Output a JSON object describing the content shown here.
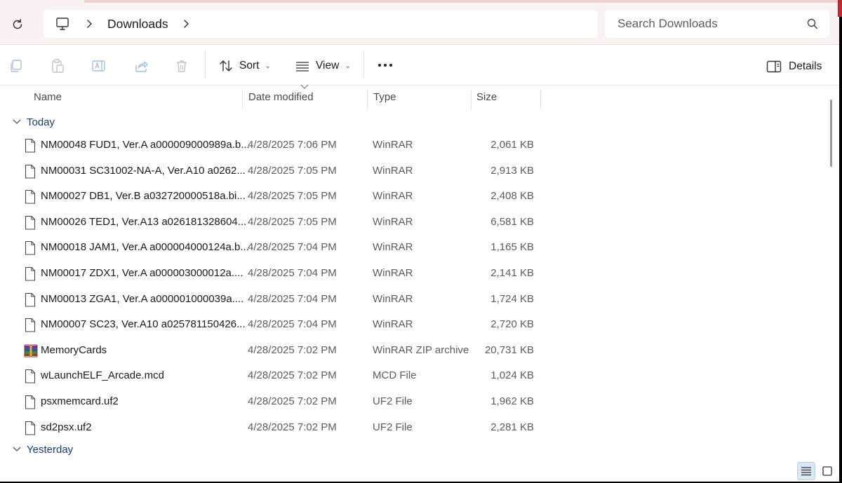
{
  "address": {
    "breadcrumb": "Downloads",
    "search_placeholder": "Search Downloads"
  },
  "toolbar": {
    "sort_label": "Sort",
    "view_label": "View",
    "details_label": "Details"
  },
  "columns": {
    "name": "Name",
    "date": "Date modified",
    "type": "Type",
    "size": "Size"
  },
  "groups": {
    "today": "Today",
    "yesterday": "Yesterday"
  },
  "files": [
    {
      "name": "NM00048 FUD1, Ver.A a000009000989a.b...",
      "date": "4/28/2025 7:06 PM",
      "type": "WinRAR",
      "size": "2,061 KB",
      "icon": "file-icon"
    },
    {
      "name": "NM00031 SC31002-NA-A, Ver.A10 a0262...",
      "date": "4/28/2025 7:05 PM",
      "type": "WinRAR",
      "size": "2,913 KB",
      "icon": "file-icon"
    },
    {
      "name": "NM00027 DB1, Ver.B a032720000518a.bi...",
      "date": "4/28/2025 7:05 PM",
      "type": "WinRAR",
      "size": "2,408 KB",
      "icon": "file-icon"
    },
    {
      "name": "NM00026 TED1, Ver.A13 a026181328604...",
      "date": "4/28/2025 7:05 PM",
      "type": "WinRAR",
      "size": "6,581 KB",
      "icon": "file-icon"
    },
    {
      "name": "NM00018 JAM1, Ver.A a000004000124a.b...",
      "date": "4/28/2025 7:04 PM",
      "type": "WinRAR",
      "size": "1,165 KB",
      "icon": "file-icon"
    },
    {
      "name": "NM00017 ZDX1, Ver.A a000003000012a....",
      "date": "4/28/2025 7:04 PM",
      "type": "WinRAR",
      "size": "2,141 KB",
      "icon": "file-icon"
    },
    {
      "name": "NM00013 ZGA1, Ver.A a000001000039a....",
      "date": "4/28/2025 7:04 PM",
      "type": "WinRAR",
      "size": "1,724 KB",
      "icon": "file-icon"
    },
    {
      "name": "NM00007 SC23, Ver.A10 a025781150426...",
      "date": "4/28/2025 7:04 PM",
      "type": "WinRAR",
      "size": "2,720 KB",
      "icon": "file-icon"
    },
    {
      "name": "MemoryCards",
      "date": "4/28/2025 7:02 PM",
      "type": "WinRAR ZIP archive",
      "size": "20,731 KB",
      "icon": "winrar-archive-icon"
    },
    {
      "name": "wLaunchELF_Arcade.mcd",
      "date": "4/28/2025 7:02 PM",
      "type": "MCD File",
      "size": "1,024 KB",
      "icon": "file-icon"
    },
    {
      "name": "psxmemcard.uf2",
      "date": "4/28/2025 7:02 PM",
      "type": "UF2 File",
      "size": "1,962 KB",
      "icon": "file-icon"
    },
    {
      "name": "sd2psx.uf2",
      "date": "4/28/2025 7:02 PM",
      "type": "UF2 File",
      "size": "2,281 KB",
      "icon": "file-icon"
    }
  ]
}
